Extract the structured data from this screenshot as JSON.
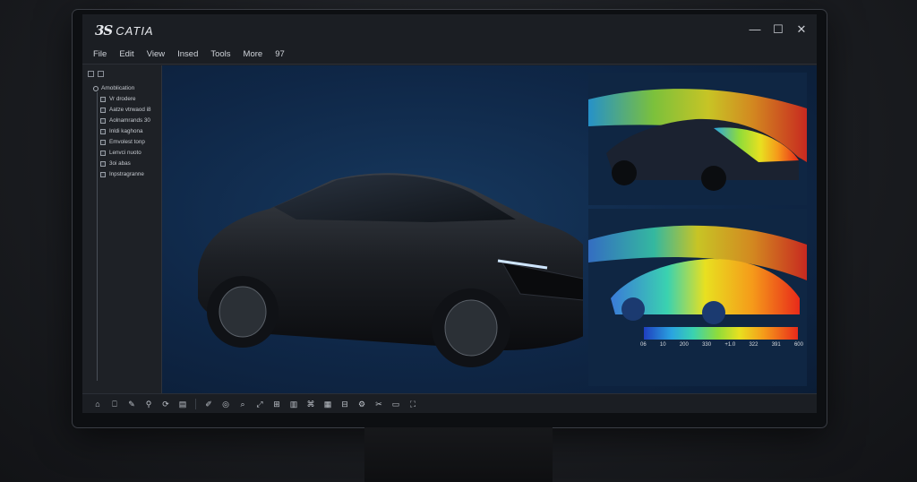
{
  "app": {
    "logo_mark": "3S",
    "title": "CATIA"
  },
  "window_controls": {
    "minimize": "—",
    "maximize": "☐",
    "close": "✕"
  },
  "menu": [
    "File",
    "Edit",
    "View",
    "Insed",
    "Tools",
    "More",
    "97"
  ],
  "tree": {
    "root": "Amoblication",
    "items": [
      "Vr drodere",
      "Aatze vtrwaod i8",
      "Aolnamrands 30",
      "Inldi kaghona",
      "Emvolest tonp",
      "Lenvci nuoto",
      "3oi abas",
      "Inpstragranne"
    ]
  },
  "scale": {
    "labels": [
      "06",
      "10",
      "200",
      "330",
      "+1.0",
      "322",
      "391",
      "600"
    ]
  },
  "toolbar": {
    "group1": [
      "⌂",
      "⎕",
      "✎",
      "⚲",
      "⟳",
      "▤"
    ],
    "group2": [
      "✐",
      "◎",
      "⌕",
      "⤢",
      "⊞",
      "▥",
      "⌘",
      "▦",
      "⊟",
      "⚙",
      "✂",
      "▭",
      "⛶"
    ]
  },
  "colors": {
    "accent_red": "#e82a1a",
    "accent_blue": "#1f3fbf",
    "viewport_bg": "#0f2747"
  }
}
